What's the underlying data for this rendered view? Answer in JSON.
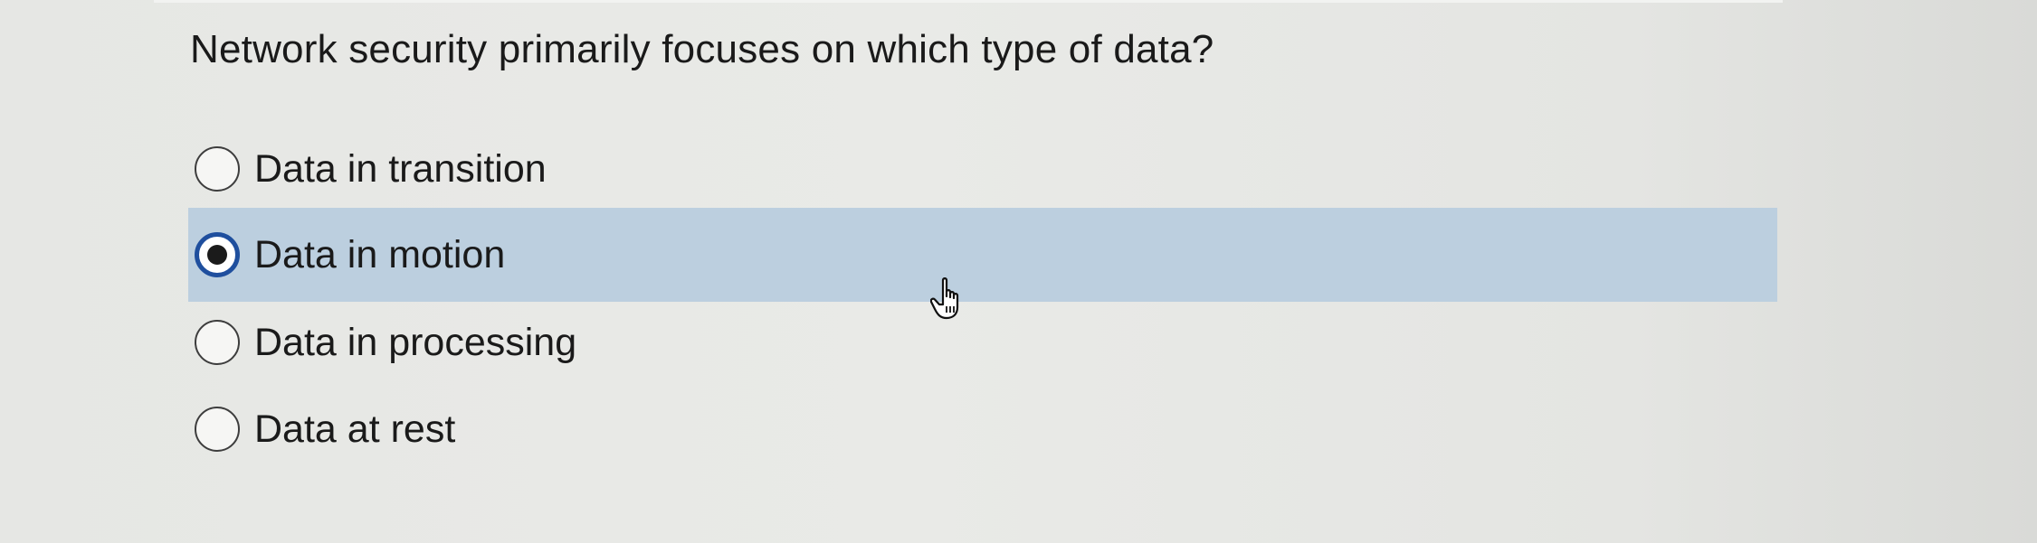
{
  "question": {
    "text": "Network security primarily focuses on which type of data?"
  },
  "options": [
    {
      "label": "Data in transition",
      "selected": false
    },
    {
      "label": "Data in motion",
      "selected": true
    },
    {
      "label": "Data in processing",
      "selected": false
    },
    {
      "label": "Data at rest",
      "selected": false
    }
  ],
  "colors": {
    "selected_row_background": "#bccfdf",
    "selected_radio_ring": "#1f4f9e",
    "text": "#1a1a1a"
  },
  "icons": {
    "cursor": "hand-pointer-icon",
    "radio": "radio-button-icon"
  }
}
